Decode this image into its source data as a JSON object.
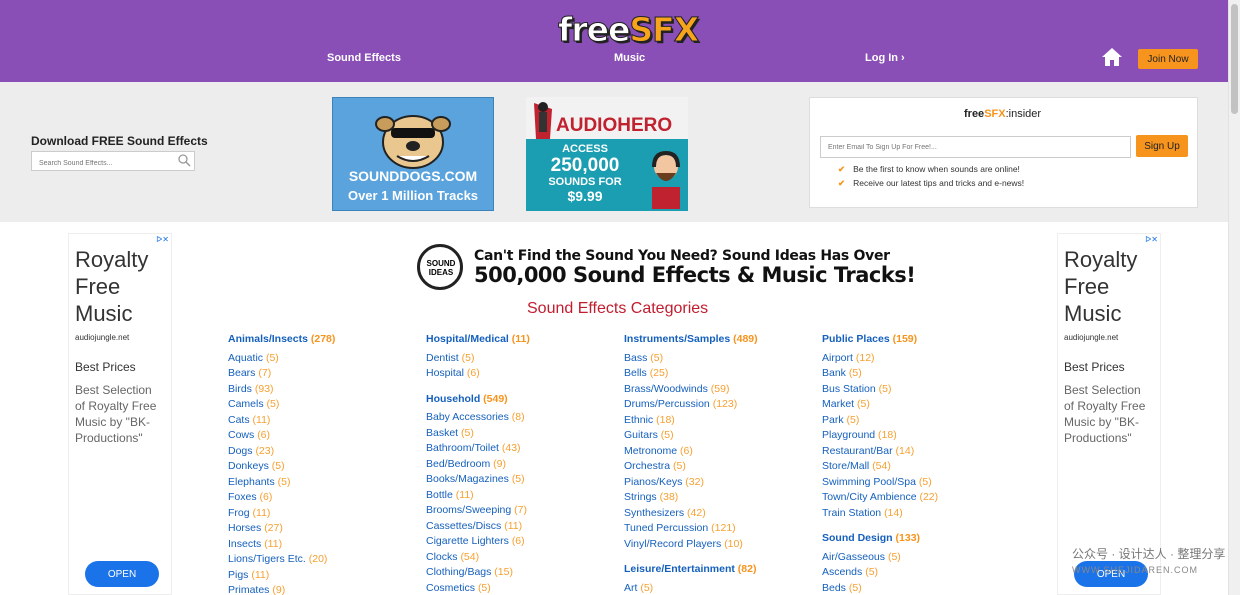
{
  "header": {
    "logo": {
      "part1": "free",
      "part2": "SFX"
    },
    "nav": {
      "sound_effects": "Sound Effects",
      "music": "Music",
      "login": "Log In ›"
    },
    "join_label": "Join Now",
    "icons": {
      "home": "home-icon"
    },
    "colors": {
      "bar": "#8a4fb6",
      "accent": "#f7941d"
    }
  },
  "download": {
    "title": "Download FREE Sound Effects",
    "search_placeholder": "Search Sound Effects..."
  },
  "ads": {
    "sounddogs": {
      "name": "SOUNDDOGS.COM",
      "tagline": "Over 1 Million Tracks"
    },
    "audiohero": {
      "name": "AUDIOHERO",
      "line1": "ACCESS",
      "line2": "250,000",
      "line3": "SOUNDS FOR",
      "price": "$9.99"
    }
  },
  "insider": {
    "logo_part1": "free",
    "logo_part2": "SFX",
    "logo_part3": ":insider",
    "email_placeholder": "Enter Email To Sign Up For Free!...",
    "signup_label": "Sign Up",
    "bullets": [
      "Be the first to know when sounds are online!",
      "Receive our latest tips and tricks and e-news!"
    ]
  },
  "side_ad": {
    "heading": "Royalty Free Music",
    "domain": "audiojungle.net",
    "prices": "Best Prices",
    "desc": "Best Selection of Royalty Free Music by \"BK-Productions\"",
    "open_label": "OPEN"
  },
  "sound_ideas": {
    "logo": "SOUND IDEAS",
    "line1": "Can't Find the Sound You Need? Sound Ideas Has Over",
    "line2": "500,000 Sound Effects & Music Tracks!"
  },
  "categories_title": "Sound Effects Categories",
  "columns": [
    {
      "groups": [
        {
          "name": "Animals/Insects",
          "count": "(278)",
          "items": [
            {
              "name": "Aquatic",
              "count": "(5)"
            },
            {
              "name": "Bears",
              "count": "(7)"
            },
            {
              "name": "Birds",
              "count": "(93)"
            },
            {
              "name": "Camels",
              "count": "(5)"
            },
            {
              "name": "Cats",
              "count": "(11)"
            },
            {
              "name": "Cows",
              "count": "(6)"
            },
            {
              "name": "Dogs",
              "count": "(23)"
            },
            {
              "name": "Donkeys",
              "count": "(5)"
            },
            {
              "name": "Elephants",
              "count": "(5)"
            },
            {
              "name": "Foxes",
              "count": "(6)"
            },
            {
              "name": "Frog",
              "count": "(11)"
            },
            {
              "name": "Horses",
              "count": "(27)"
            },
            {
              "name": "Insects",
              "count": "(11)"
            },
            {
              "name": "Lions/Tigers Etc.",
              "count": "(20)"
            },
            {
              "name": "Pigs",
              "count": "(11)"
            },
            {
              "name": "Primates",
              "count": "(9)"
            }
          ]
        }
      ]
    },
    {
      "groups": [
        {
          "name": "Hospital/Medical",
          "count": "(11)",
          "items": [
            {
              "name": "Dentist",
              "count": "(5)"
            },
            {
              "name": "Hospital",
              "count": "(6)"
            }
          ]
        },
        {
          "name": "Household",
          "count": "(549)",
          "items": [
            {
              "name": "Baby Accessories",
              "count": "(8)"
            },
            {
              "name": "Basket",
              "count": "(5)"
            },
            {
              "name": "Bathroom/Toilet",
              "count": "(43)"
            },
            {
              "name": "Bed/Bedroom",
              "count": "(9)"
            },
            {
              "name": "Books/Magazines",
              "count": "(5)"
            },
            {
              "name": "Bottle",
              "count": "(11)"
            },
            {
              "name": "Brooms/Sweeping",
              "count": "(7)"
            },
            {
              "name": "Cassettes/Discs",
              "count": "(11)"
            },
            {
              "name": "Cigarette Lighters",
              "count": "(6)"
            },
            {
              "name": "Clocks",
              "count": "(54)"
            },
            {
              "name": "Clothing/Bags",
              "count": "(15)"
            },
            {
              "name": "Cosmetics",
              "count": "(5)"
            }
          ]
        }
      ]
    },
    {
      "groups": [
        {
          "name": "Instruments/Samples",
          "count": "(489)",
          "items": [
            {
              "name": "Bass",
              "count": "(5)"
            },
            {
              "name": "Bells",
              "count": "(25)"
            },
            {
              "name": "Brass/Woodwinds",
              "count": "(59)"
            },
            {
              "name": "Drums/Percussion",
              "count": "(123)"
            },
            {
              "name": "Ethnic",
              "count": "(18)"
            },
            {
              "name": "Guitars",
              "count": "(5)"
            },
            {
              "name": "Metronome",
              "count": "(6)"
            },
            {
              "name": "Orchestra",
              "count": "(5)"
            },
            {
              "name": "Pianos/Keys",
              "count": "(32)"
            },
            {
              "name": "Strings",
              "count": "(38)"
            },
            {
              "name": "Synthesizers",
              "count": "(42)"
            },
            {
              "name": "Tuned Percussion",
              "count": "(121)"
            },
            {
              "name": "Vinyl/Record Players",
              "count": "(10)"
            }
          ]
        },
        {
          "name": "Leisure/Entertainment",
          "count": "(82)",
          "items": [
            {
              "name": "Art",
              "count": "(5)"
            }
          ]
        }
      ]
    },
    {
      "groups": [
        {
          "name": "Public Places",
          "count": "(159)",
          "items": [
            {
              "name": "Airport",
              "count": "(12)"
            },
            {
              "name": "Bank",
              "count": "(5)"
            },
            {
              "name": "Bus Station",
              "count": "(5)"
            },
            {
              "name": "Market",
              "count": "(5)"
            },
            {
              "name": "Park",
              "count": "(5)"
            },
            {
              "name": "Playground",
              "count": "(18)"
            },
            {
              "name": "Restaurant/Bar",
              "count": "(14)"
            },
            {
              "name": "Store/Mall",
              "count": "(54)"
            },
            {
              "name": "Swimming Pool/Spa",
              "count": "(5)"
            },
            {
              "name": "Town/City Ambience",
              "count": "(22)"
            },
            {
              "name": "Train Station",
              "count": "(14)"
            }
          ]
        },
        {
          "name": "Sound Design",
          "count": "(133)",
          "items": [
            {
              "name": "Air/Gasseous",
              "count": "(5)"
            },
            {
              "name": "Ascends",
              "count": "(5)"
            },
            {
              "name": "Beds",
              "count": "(5)"
            }
          ]
        }
      ]
    }
  ],
  "watermark": {
    "line1": "公众号 · 设计达人 · 整理分享",
    "line2": "WWW.SHEJIDAREN.COM"
  }
}
